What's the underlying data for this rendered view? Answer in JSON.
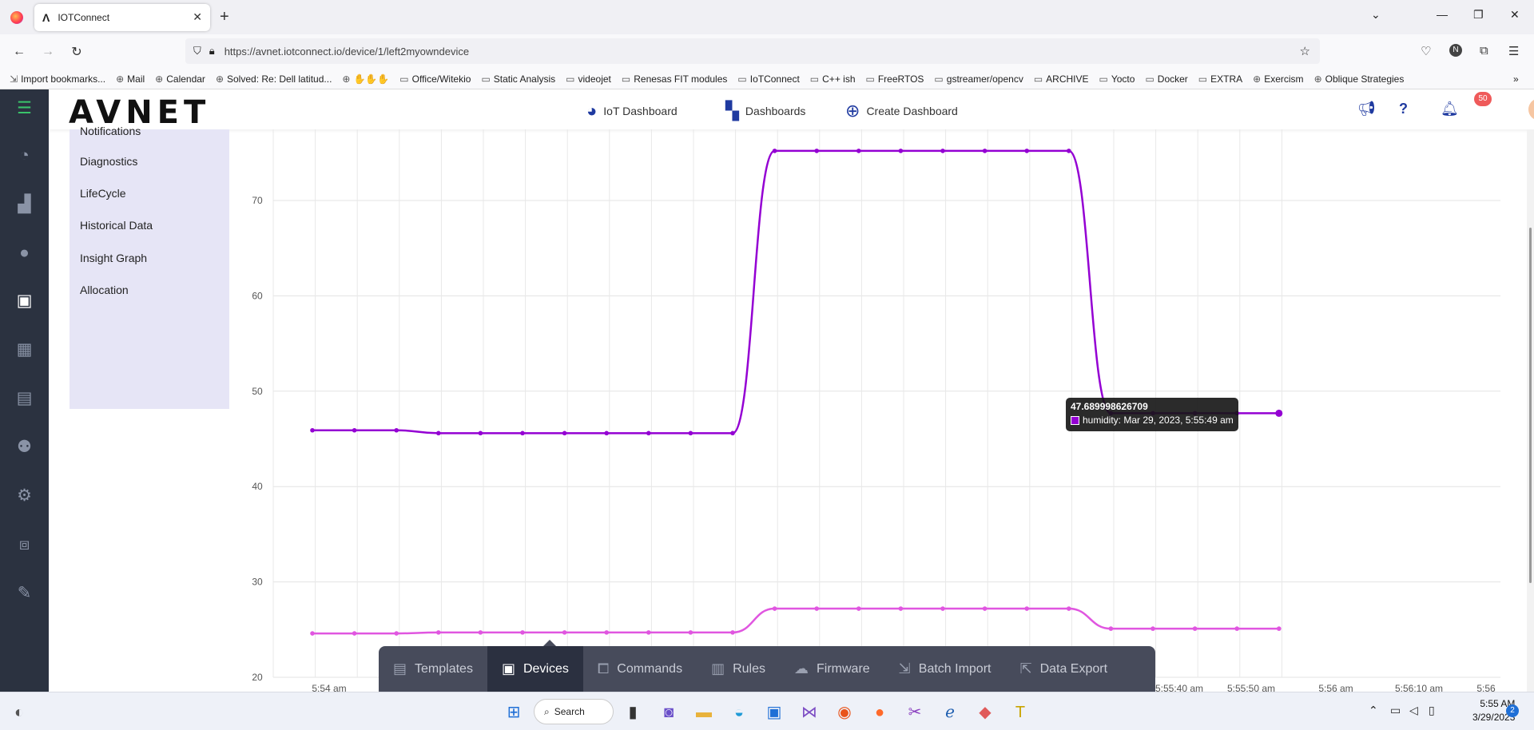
{
  "browser": {
    "tab_title": "IOTConnect",
    "url": "https://avnet.iotconnect.io/device/1/left2myowndevice",
    "profile_initial": "N",
    "bookmarks": [
      "Import bookmarks...",
      "Mail",
      "Calendar",
      "Solved: Re: Dell latitud...",
      "Office/Witekio",
      "Static Analysis",
      "videojet",
      "Renesas FIT modules",
      "IoTConnect",
      "C++ ish",
      "FreeRTOS",
      "gstreamer/opencv",
      "ARCHIVE",
      "Yocto",
      "Docker",
      "EXTRA",
      "Exercism",
      "Oblique Strategies"
    ]
  },
  "header": {
    "brand": "AVNET",
    "nav": [
      "IoT Dashboard",
      "Dashboards",
      "Create Dashboard"
    ],
    "notification_count": "50"
  },
  "sidebar_icons": [
    "menu-icon",
    "dashboard-icon",
    "analytics-icon",
    "user-icon",
    "device-chip-icon",
    "calendar-icon",
    "reports-icon",
    "users-icon",
    "settings-icon",
    "cubes-icon",
    "tools-icon"
  ],
  "subnav": {
    "items": [
      "Notifications",
      "Diagnostics",
      "LifeCycle",
      "Historical Data",
      "Insight Graph",
      "Allocation"
    ]
  },
  "chart_data": {
    "type": "line",
    "ylim": [
      20,
      75
    ],
    "yticks": [
      20,
      30,
      40,
      50,
      60,
      70
    ],
    "x_tick_labels": [
      "5:54 am",
      "5:55:40 am",
      "5:55:50 am",
      "5:56 am",
      "5:56:10 am",
      "5:56"
    ],
    "series": [
      {
        "name": "humidity",
        "color": "#9400d3",
        "values": [
          45.9,
          45.9,
          45.9,
          45.6,
          45.6,
          45.6,
          45.6,
          45.6,
          45.6,
          45.6,
          45.6,
          75.2,
          75.2,
          75.2,
          75.2,
          75.2,
          75.2,
          75.2,
          75.2,
          47.69,
          47.69,
          47.69,
          47.69,
          47.69
        ]
      },
      {
        "color": "#e056e0",
        "values": [
          24.6,
          24.6,
          24.6,
          24.7,
          24.7,
          24.7,
          24.7,
          24.7,
          24.7,
          24.7,
          24.7,
          27.2,
          27.2,
          27.2,
          27.2,
          27.2,
          27.2,
          27.2,
          27.2,
          25.1,
          25.1,
          25.1,
          25.1,
          25.1
        ]
      }
    ],
    "tooltip": {
      "value": "47.689998626709",
      "label": "humidity: Mar 29, 2023, 5:55:49 am"
    }
  },
  "toolbar": {
    "items": [
      "Templates",
      "Devices",
      "Commands",
      "Rules",
      "Firmware",
      "Batch Import",
      "Data Export"
    ],
    "active": "Devices"
  },
  "taskbar": {
    "search_label": "Search",
    "time": "5:55 AM",
    "date": "3/29/2023",
    "notification_count": "2"
  }
}
